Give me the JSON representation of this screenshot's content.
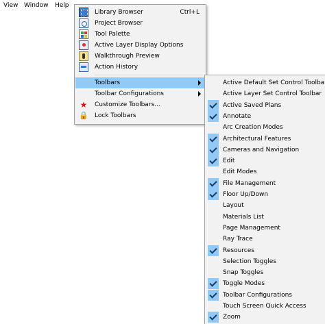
{
  "menubar": {
    "items": [
      {
        "label": "View"
      },
      {
        "label": "Window"
      },
      {
        "label": "Help"
      }
    ]
  },
  "window_menu": {
    "items": [
      {
        "label": "Library Browser",
        "shortcut": "Ctrl+L",
        "icon": "library-browser-icon"
      },
      {
        "label": "Project Browser",
        "icon": "project-browser-icon"
      },
      {
        "label": "Tool Palette",
        "icon": "tool-palette-icon"
      },
      {
        "label": "Active Layer Display Options",
        "icon": "layer-display-icon"
      },
      {
        "label": "Walkthrough Preview",
        "icon": "walkthrough-icon"
      },
      {
        "label": "Action History",
        "icon": "action-history-icon"
      },
      {
        "label": "Toolbars",
        "highlighted": true,
        "submenu": true
      },
      {
        "label": "Toolbar Configurations",
        "submenu": true
      },
      {
        "label": "Customize Toolbars...",
        "icon": "star-icon"
      },
      {
        "label": "Lock Toolbars",
        "icon": "lock-icon"
      }
    ]
  },
  "toolbars_menu": {
    "items": [
      {
        "label": "Active Default Set Control Toolbar",
        "checked": false
      },
      {
        "label": "Active Layer Set Control Toolbar",
        "checked": false
      },
      {
        "label": "Active Saved Plans",
        "checked": true
      },
      {
        "label": "Annotate",
        "checked": true
      },
      {
        "label": "Arc Creation Modes",
        "checked": false
      },
      {
        "label": "Architectural Features",
        "checked": true
      },
      {
        "label": "Cameras and Navigation",
        "checked": true
      },
      {
        "label": "Edit",
        "checked": true
      },
      {
        "label": "Edit Modes",
        "checked": false
      },
      {
        "label": "File Management",
        "checked": true
      },
      {
        "label": "Floor Up/Down",
        "checked": true
      },
      {
        "label": "Layout",
        "checked": false
      },
      {
        "label": "Materials List",
        "checked": false
      },
      {
        "label": "Page Management",
        "checked": false
      },
      {
        "label": "Ray Trace",
        "checked": false
      },
      {
        "label": "Resources",
        "checked": true
      },
      {
        "label": "Selection Toggles",
        "checked": false
      },
      {
        "label": "Snap Toggles",
        "checked": false
      },
      {
        "label": "Toggle Modes",
        "checked": true
      },
      {
        "label": "Toolbar Configurations",
        "checked": true
      },
      {
        "label": "Touch Screen Quick Access",
        "checked": false
      },
      {
        "label": "Zoom",
        "checked": true
      }
    ]
  },
  "colors": {
    "highlight": "#91c9f7",
    "menu_bg": "#f2f2f2"
  }
}
